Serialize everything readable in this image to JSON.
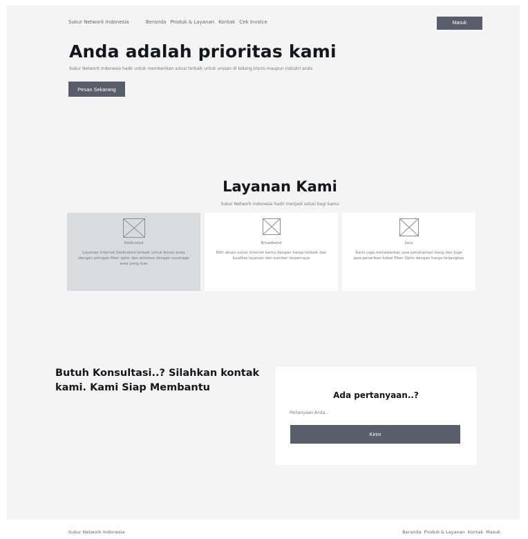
{
  "nav": {
    "brand": "Sukur Network Indonesia",
    "links": [
      "Beranda",
      "Produk & Layanan",
      "Kontak",
      "Cek Invoice"
    ],
    "login_label": "Masuk"
  },
  "hero": {
    "title": "Anda adalah prioritas kami",
    "subtitle": "Sukur Network Indonesia hadir untuk memberikan solusi terbaik untuk urusan di bidang bisnis maupun industri anda",
    "cta_label": "Pesan Sekarang"
  },
  "services": {
    "title": "Layanan Kami",
    "subtitle": "Sukur Network Indonesia hadir menjadi solusi bagi kamu",
    "cards": [
      {
        "title": "Dedicated",
        "description": "Layanan Internet Dedicated terbaik untuk bisnis anda dengan jaringan fiber optic dan wireless dengan coverage area yang luas"
      },
      {
        "title": "Broadband",
        "description": "Pilih akses solusi internet kamu dengan harga terbaik dan kualitas layanan dan sumber terpercaya"
      },
      {
        "title": "Jasa",
        "description": "Kami juga menawarkan jasa penanaman tiang dan juga jasa penarikan kabel Fiber Optic dengan harga terjangkau"
      }
    ]
  },
  "consult": {
    "title": "Butuh Konsultasi..? Silahkan kontak kami. Kami Siap Membantu",
    "form_title": "Ada pertanyaan..?",
    "input_placeholder": "Pertanyaan Anda...",
    "send_label": "Kirim"
  },
  "footer": {
    "brand": "Sukur Network Indonesia",
    "links": [
      "Beranda",
      "Produk & Layanan",
      "Kontak",
      "Masuk"
    ]
  },
  "colors": {
    "page_background": "#f4f4f5",
    "button": "#5a5e6a",
    "active_card": "#dadbde",
    "heading": "#15151c"
  },
  "icons": {
    "card_image": "image-placeholder-icon"
  }
}
